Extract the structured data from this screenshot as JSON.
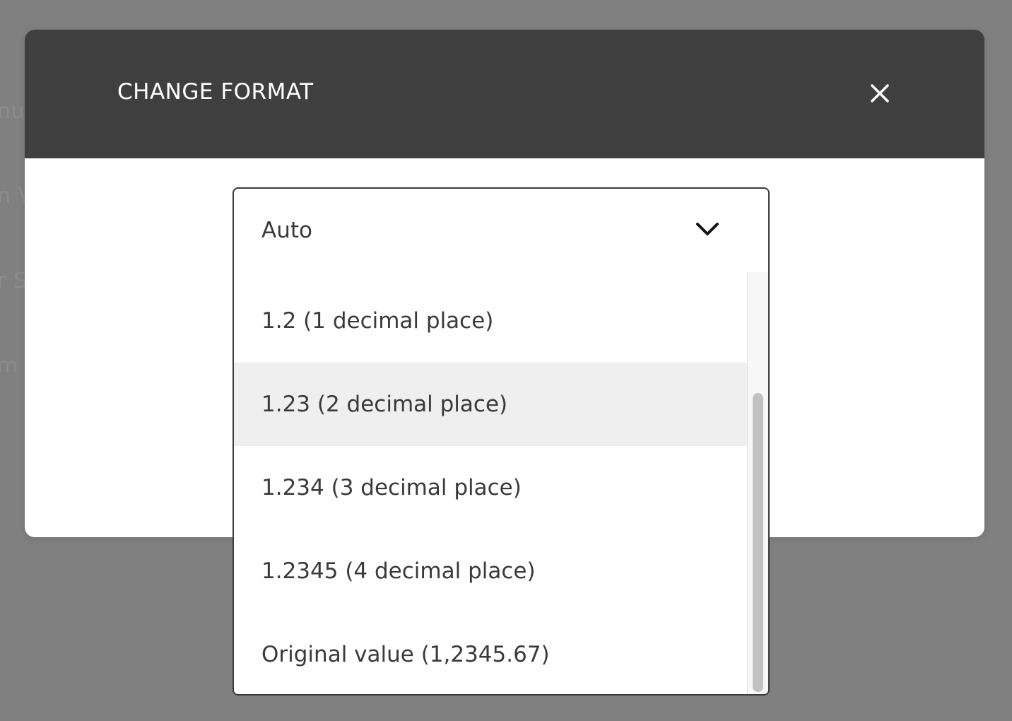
{
  "background": {
    "fragments": [
      "nu",
      "n V",
      "r S",
      "m"
    ]
  },
  "modal": {
    "title": "CHANGE FORMAT",
    "close_icon": "close-icon",
    "header_color": "#3f3f3f"
  },
  "format_select": {
    "selected": "Auto",
    "chevron_icon": "chevron-down-icon",
    "options": [
      {
        "label": "1.2 (1 decimal place)",
        "hovered": false
      },
      {
        "label": "1.23 (2 decimal place)",
        "hovered": true
      },
      {
        "label": "1.234 (3 decimal place)",
        "hovered": false
      },
      {
        "label": "1.2345 (4 decimal place)",
        "hovered": false
      },
      {
        "label": "Original value (1,2345.67)",
        "hovered": false
      }
    ]
  }
}
